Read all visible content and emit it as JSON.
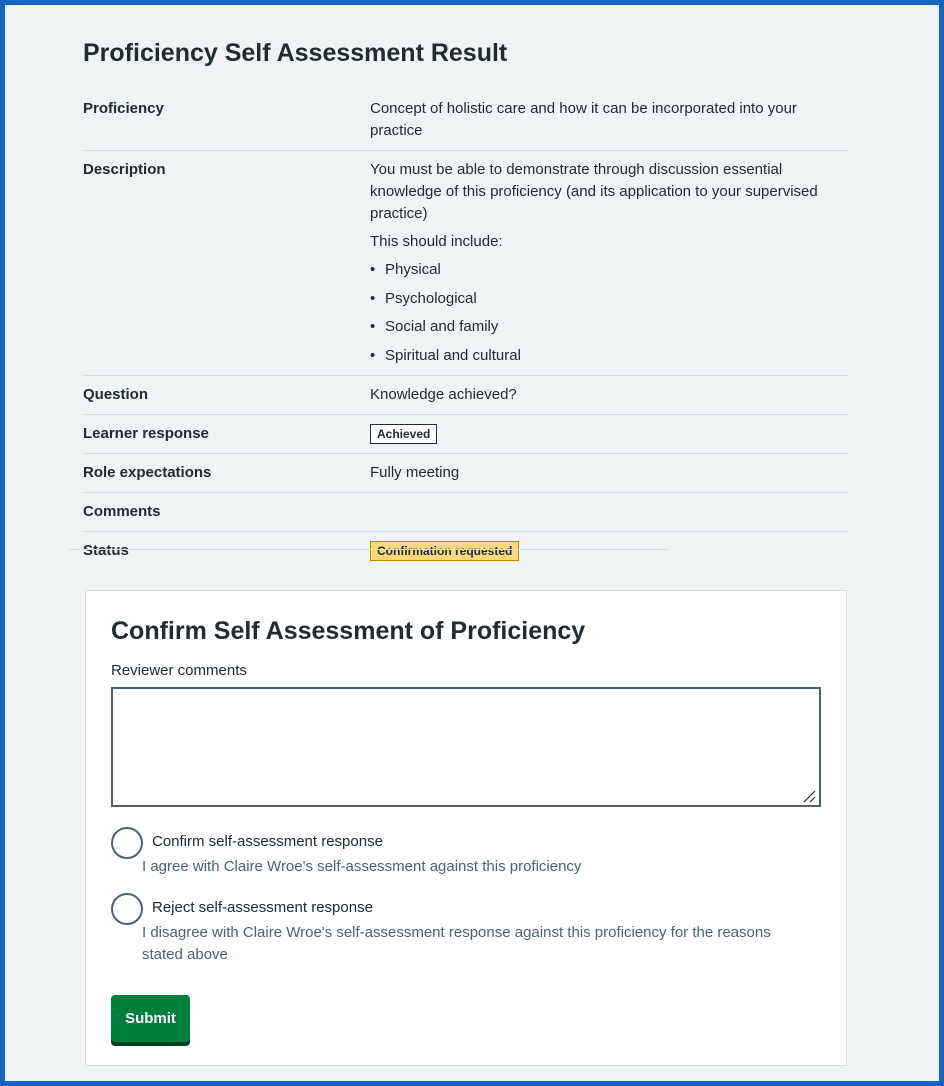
{
  "page": {
    "title": "Proficiency Self Assessment Result"
  },
  "summary": {
    "proficiency": {
      "key": "Proficiency",
      "value": "Concept of holistic care and how it can be incorporated into your practice"
    },
    "description": {
      "key": "Description",
      "value": "You must be able to demonstrate through discussion essential knowledge of this proficiency (and its application to your supervised practice)",
      "intro": "This should include:",
      "items": [
        "Physical",
        "Psychological",
        "Social and family",
        "Spiritual and cultural"
      ]
    },
    "question": {
      "key": "Question",
      "value": "Knowledge achieved?"
    },
    "learner_response": {
      "key": "Learner response",
      "value": "Achieved"
    },
    "role_expectations": {
      "key": "Role expectations",
      "value": "Fully meeting"
    },
    "comments": {
      "key": "Comments",
      "value": ""
    },
    "status": {
      "key": "Status",
      "value": "Confirmation requested"
    }
  },
  "confirm": {
    "title": "Confirm Self Assessment of Proficiency",
    "comments_label": "Reviewer comments",
    "comments_value": "",
    "options": [
      {
        "label": "Confirm self-assessment response",
        "hint": "I agree with Claire Wroe's self-assessment against this proficiency"
      },
      {
        "label": "Reject self-assessment response",
        "hint": "I disagree with Claire Wroe's self-assessment response against this proficiency for the reasons stated above"
      }
    ],
    "submit_label": "Submit"
  },
  "colors": {
    "frame_border": "#1565c0",
    "background": "#f0f4f5",
    "submit_button": "#007f3b",
    "status_tag": "#ffd87a"
  }
}
